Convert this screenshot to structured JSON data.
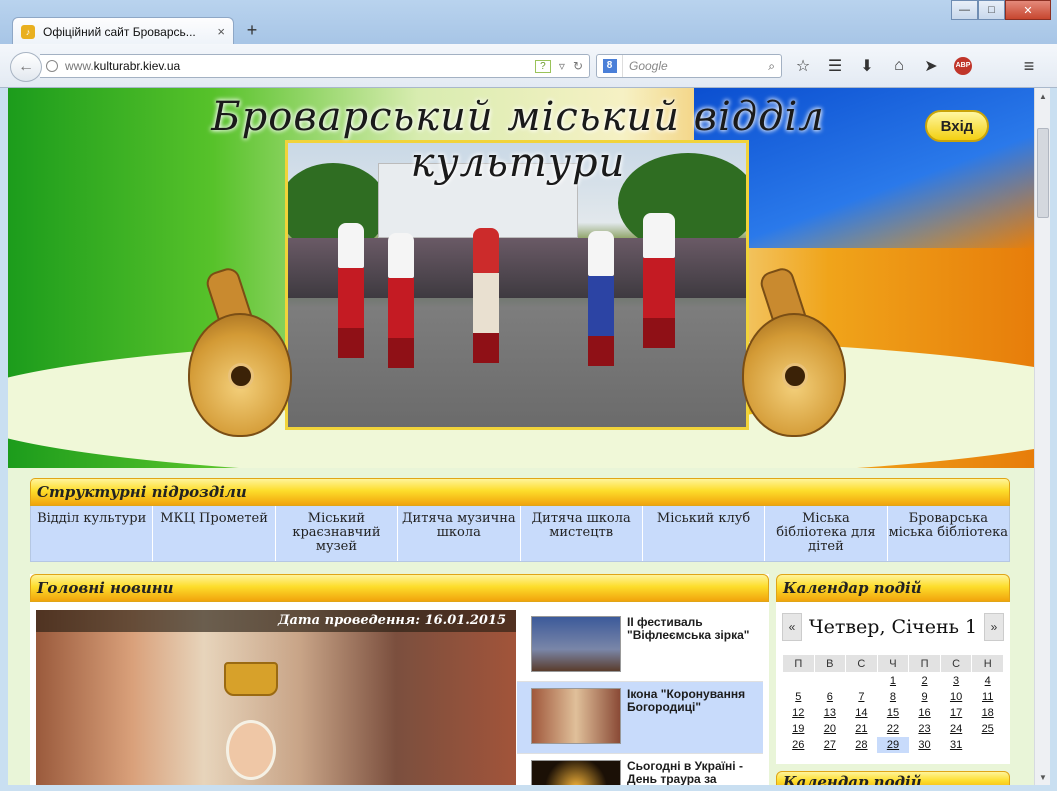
{
  "browser": {
    "tab_title": "Офіційний сайт Броварсь...",
    "tab_close": "×",
    "new_tab": "+",
    "url_prefix": "www.",
    "url_host": "kulturabr.kiev.ua",
    "search_placeholder": "Google",
    "window_minimize": "—",
    "window_maximize": "□",
    "window_close": "✕",
    "icons": [
      "back-icon",
      "globe-icon",
      "help-icon",
      "dropdown-icon",
      "reload-icon",
      "search-engine-icon",
      "search-icon",
      "bookmark-star-icon",
      "bookmarks-list-icon",
      "download-icon",
      "home-icon",
      "share-icon",
      "adblock-icon",
      "menu-icon"
    ],
    "abp_label": "ABP"
  },
  "site": {
    "title": "Броварський міський відділ культури",
    "login_label": "Вхід"
  },
  "structure": {
    "heading": "Структурні підрозділи",
    "items": [
      "Відділ культури",
      "МКЦ Прометей",
      "Міський краєзнавчий музей",
      "Дитяча музична школа",
      "Дитяча школа мистецтв",
      "Міський клуб",
      "Міська бібліотека для дітей",
      "Броварська міська бібліотека"
    ]
  },
  "news": {
    "heading": "Головні новини",
    "date_label": "Дата проведення: 16.01.2015",
    "items": [
      "ІІ фестиваль \"Віфлеємська зірка\"",
      "Ікона \"Коронування Богородиці\"",
      "Сьогодні в Україні - День траура за"
    ]
  },
  "calendar": {
    "heading": "Календар подій",
    "prev": "«",
    "next": "»",
    "month_label": "Четвер, Січень 1",
    "weekdays": [
      "П",
      "В",
      "С",
      "Ч",
      "П",
      "С",
      "Н"
    ],
    "weeks": [
      [
        "",
        "",
        "",
        "1",
        "2",
        "3",
        "4"
      ],
      [
        "5",
        "6",
        "7",
        "8",
        "9",
        "10",
        "11"
      ],
      [
        "12",
        "13",
        "14",
        "15",
        "16",
        "17",
        "18"
      ],
      [
        "19",
        "20",
        "21",
        "22",
        "23",
        "24",
        "25"
      ],
      [
        "26",
        "27",
        "28",
        "29",
        "30",
        "31",
        ""
      ]
    ],
    "today": "29"
  },
  "next_section_heading": "Календар подій",
  "colors": {
    "header_yellow": "#fddd2b",
    "menu_blue": "#c8dbfb",
    "active_news": "#c8dbfb"
  }
}
